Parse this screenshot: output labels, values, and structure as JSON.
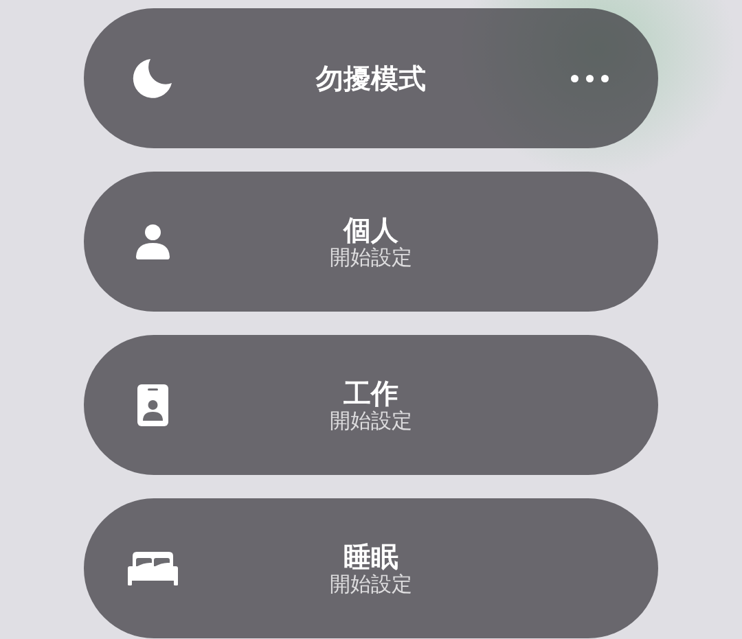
{
  "focus_modes": [
    {
      "kind": "dnd",
      "title": "勿擾模式",
      "more_button": true
    },
    {
      "kind": "personal",
      "title": "個人",
      "subtitle": "開始設定",
      "more_button": false
    },
    {
      "kind": "work",
      "title": "工作",
      "subtitle": "開始設定",
      "more_button": false
    },
    {
      "kind": "sleep",
      "title": "睡眠",
      "subtitle": "開始設定",
      "more_button": false
    }
  ]
}
